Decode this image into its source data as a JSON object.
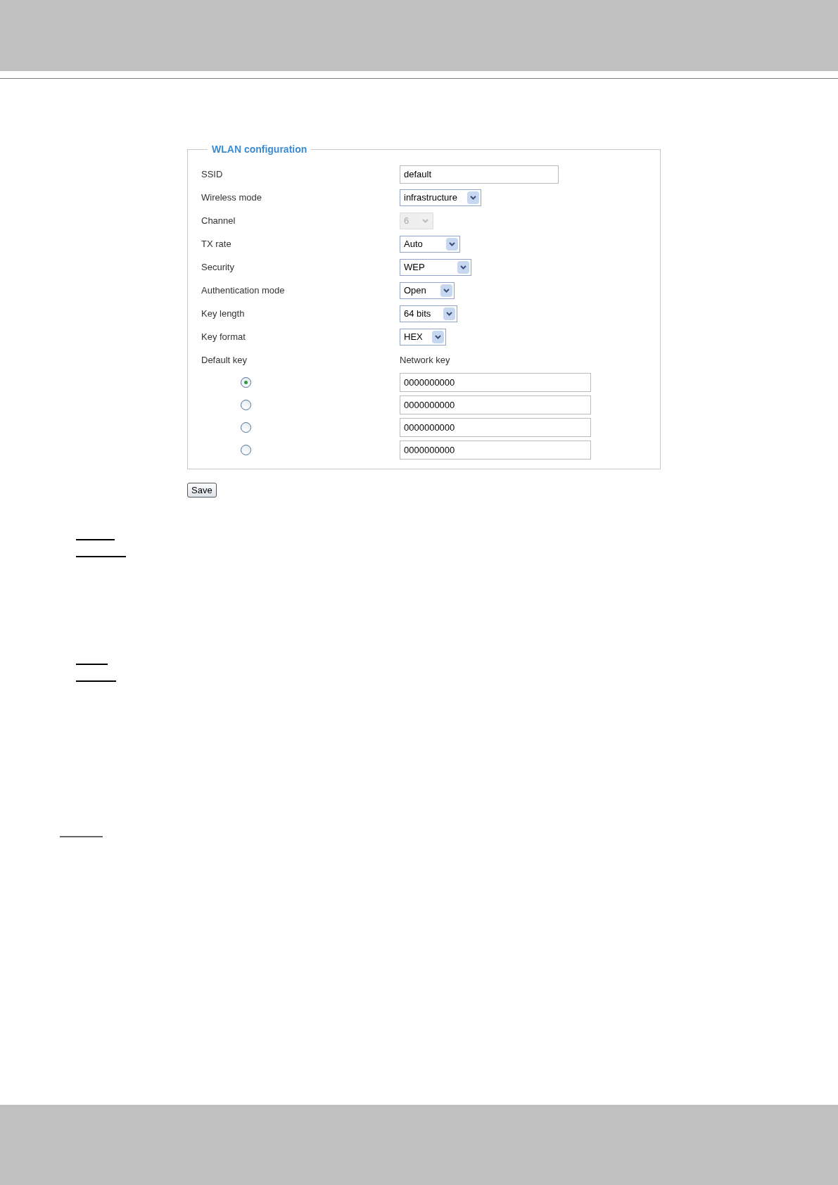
{
  "panel": {
    "title": "WLAN configuration",
    "fields": [
      {
        "label": "SSID",
        "kind": "text",
        "value": "default"
      },
      {
        "label": "Wireless mode",
        "kind": "select",
        "value": "infrastructure",
        "disabled": false
      },
      {
        "label": "Channel",
        "kind": "select",
        "value": "6",
        "disabled": true
      },
      {
        "label": "TX rate",
        "kind": "select",
        "value": "Auto",
        "disabled": false
      },
      {
        "label": "Security",
        "kind": "select",
        "value": "WEP",
        "disabled": false
      },
      {
        "label": "Authentication mode",
        "kind": "select",
        "value": "Open",
        "disabled": false
      },
      {
        "label": "Key length",
        "kind": "select",
        "value": "64 bits",
        "disabled": false
      },
      {
        "label": "Key format",
        "kind": "select",
        "value": "HEX",
        "disabled": false
      }
    ],
    "keys_heading": {
      "default_key": "Default key",
      "network_key": "Network key"
    },
    "keys": [
      {
        "selected": true,
        "value": "0000000000"
      },
      {
        "selected": false,
        "value": "0000000000"
      },
      {
        "selected": false,
        "value": "0000000000"
      },
      {
        "selected": false,
        "value": "0000000000"
      }
    ]
  },
  "save_button": "Save"
}
